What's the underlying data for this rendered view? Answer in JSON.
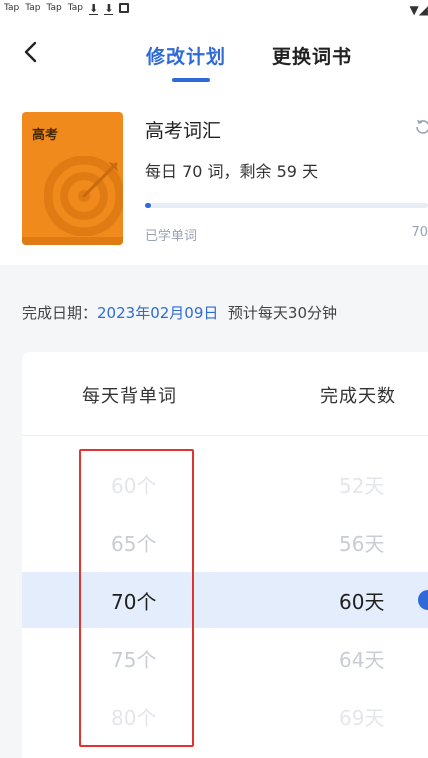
{
  "status_bar": {
    "apps": [
      "Tap",
      "Tap",
      "Tap",
      "Tap"
    ]
  },
  "header": {
    "tabs": [
      {
        "label": "修改计划",
        "active": true
      },
      {
        "label": "更换词书",
        "active": false
      }
    ]
  },
  "book": {
    "cover_tag": "高考",
    "title": "高考词汇",
    "plan": "每日 70 词，剩余 59 天",
    "progress_fraction": 0.02,
    "learned_label": "已学单词",
    "total_words": "70"
  },
  "finish": {
    "label": "完成日期：",
    "date": "2023年02月09日",
    "estimate": "预计每天30分钟"
  },
  "picker": {
    "headers": {
      "left": "每天背单词",
      "right": "完成天数"
    },
    "rows": [
      {
        "count": "60个",
        "days": "52天",
        "state": "faint"
      },
      {
        "count": "65个",
        "days": "56天",
        "state": "mid"
      },
      {
        "count": "70个",
        "days": "60天",
        "state": "selected"
      },
      {
        "count": "75个",
        "days": "64天",
        "state": "mid"
      },
      {
        "count": "80个",
        "days": "69天",
        "state": "faint"
      }
    ]
  },
  "colors": {
    "accent": "#2f6bd8",
    "book_cover": "#f08a1c",
    "highlight": "#e0342f",
    "selected_row": "#e3edfc"
  }
}
